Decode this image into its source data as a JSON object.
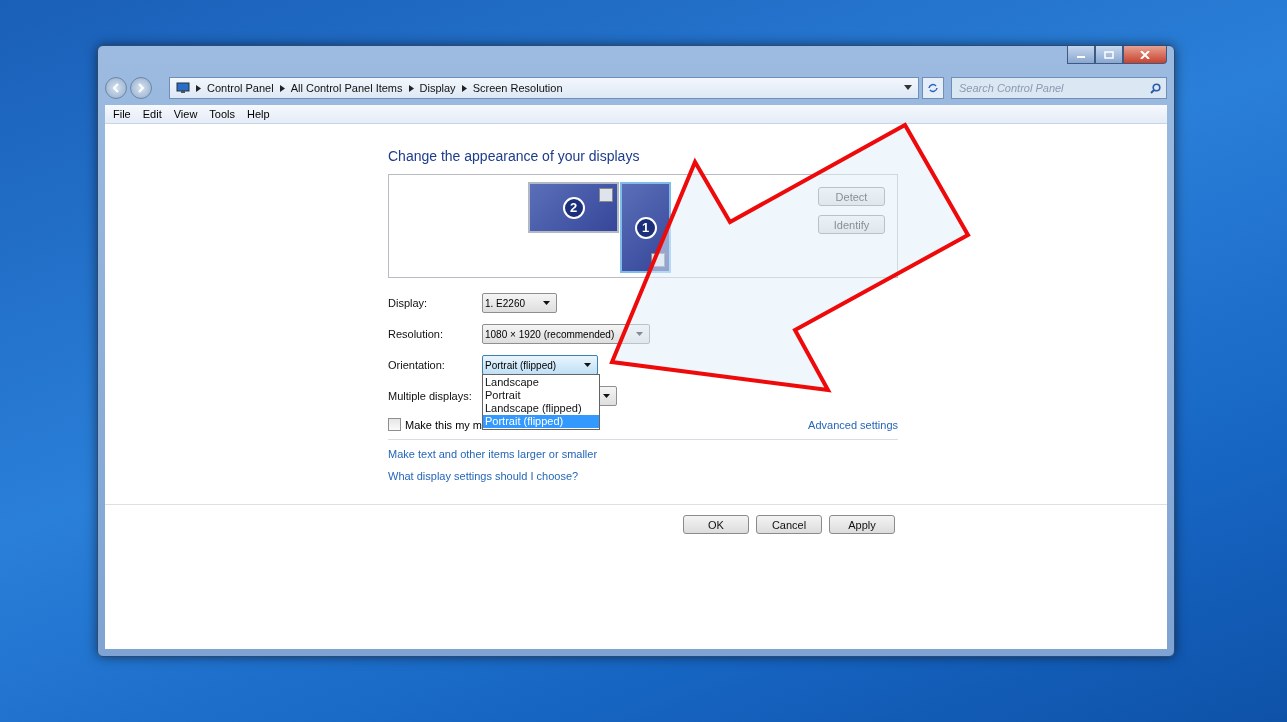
{
  "address_bar": {
    "breadcrumb": [
      "Control Panel",
      "All Control Panel Items",
      "Display",
      "Screen Resolution"
    ]
  },
  "search": {
    "placeholder": "Search Control Panel"
  },
  "menu": [
    "File",
    "Edit",
    "View",
    "Tools",
    "Help"
  ],
  "heading": "Change the appearance of your displays",
  "monitors": [
    {
      "number": "2",
      "selected": false
    },
    {
      "number": "1",
      "selected": true
    }
  ],
  "side_buttons": [
    "Detect",
    "Identify"
  ],
  "fields": [
    {
      "label": "Display:",
      "value": "1. E2260",
      "expanded": false
    },
    {
      "label": "Resolution:",
      "value": "1080 × 1920 (recommended)",
      "expanded": false
    },
    {
      "label": "Orientation:",
      "value": "Portrait (flipped)",
      "expanded": true,
      "options": [
        {
          "label": "Landscape",
          "selected": false
        },
        {
          "label": "Portrait",
          "selected": false
        },
        {
          "label": "Landscape (flipped)",
          "selected": false
        },
        {
          "label": "Portrait (flipped)",
          "selected": true
        }
      ]
    },
    {
      "label": "Multiple displays:",
      "expanded": false
    }
  ],
  "main_display": {
    "label": "Make this my m",
    "checked": false
  },
  "advanced_link": "Advanced settings",
  "links": [
    "Make text and other items larger or smaller",
    "What display settings should I choose?"
  ],
  "buttons": [
    "OK",
    "Cancel",
    "Apply"
  ]
}
